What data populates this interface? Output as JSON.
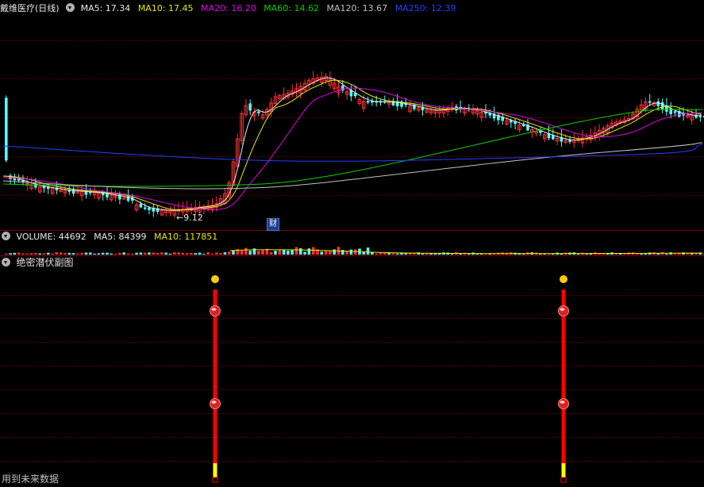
{
  "main_panel": {
    "title": "戴维医疗(日线)",
    "indicators": [
      {
        "label": "MA5: 17.34",
        "color": "#e8e8e8"
      },
      {
        "label": "MA10: 17.45",
        "color": "#e8e800"
      },
      {
        "label": "MA20: 16.20",
        "color": "#e000e0"
      },
      {
        "label": "MA60: 14.62",
        "color": "#00d000"
      },
      {
        "label": "MA120: 13.67",
        "color": "#c0c0c0"
      },
      {
        "label": "MA250: 12.39",
        "color": "#2040ff"
      }
    ],
    "low_marker": "←9.12",
    "event_badge": "财"
  },
  "volume_panel": {
    "label": "VOLUME: 44692",
    "ma5": "MA5: 84399",
    "ma10": "MA10: 117851"
  },
  "sub_panel": {
    "title": "绝密潜伏副图",
    "footer": "用到未来数据"
  },
  "colors": {
    "up": "#ff3030",
    "down": "#54fcfc",
    "grid": "#6a0000",
    "signal": "#ff0000",
    "signal_tip": "#ffff00",
    "dot": "#ffcc00"
  }
}
